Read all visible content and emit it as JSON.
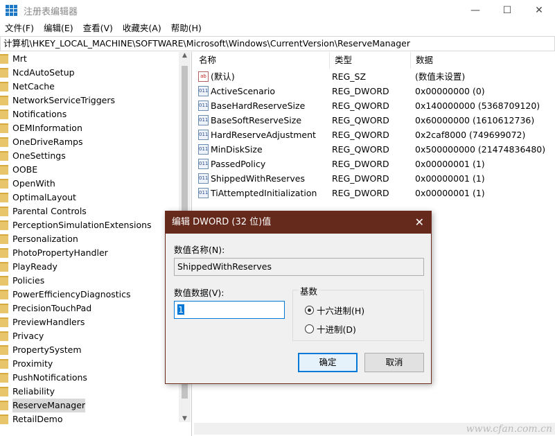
{
  "window": {
    "title": "注册表编辑器",
    "minimize": "—",
    "maximize": "☐",
    "close": "✕"
  },
  "menu": [
    "文件(F)",
    "编辑(E)",
    "查看(V)",
    "收藏夹(A)",
    "帮助(H)"
  ],
  "address": "计算机\\HKEY_LOCAL_MACHINE\\SOFTWARE\\Microsoft\\Windows\\CurrentVersion\\ReserveManager",
  "tree": {
    "items": [
      "Mrt",
      "NcdAutoSetup",
      "NetCache",
      "NetworkServiceTriggers",
      "Notifications",
      "OEMInformation",
      "OneDriveRamps",
      "OneSettings",
      "OOBE",
      "OpenWith",
      "OptimalLayout",
      "Parental Controls",
      "PerceptionSimulationExtensions",
      "Personalization",
      "PhotoPropertyHandler",
      "PlayReady",
      "Policies",
      "PowerEfficiencyDiagnostics",
      "PrecisionTouchPad",
      "PreviewHandlers",
      "Privacy",
      "PropertySystem",
      "Proximity",
      "PushNotifications",
      "Reliability",
      "ReserveManager",
      "RetailDemo"
    ],
    "selected": "ReserveManager"
  },
  "list": {
    "headers": [
      "名称",
      "类型",
      "数据"
    ],
    "rows": [
      {
        "icon": "string-value-icon",
        "name": "(默认)",
        "type": "REG_SZ",
        "data": "(数值未设置)"
      },
      {
        "icon": "binary-value-icon",
        "name": "ActiveScenario",
        "type": "REG_DWORD",
        "data": "0x00000000 (0)"
      },
      {
        "icon": "binary-value-icon",
        "name": "BaseHardReserveSize",
        "type": "REG_QWORD",
        "data": "0x140000000 (5368709120)"
      },
      {
        "icon": "binary-value-icon",
        "name": "BaseSoftReserveSize",
        "type": "REG_QWORD",
        "data": "0x60000000 (1610612736)"
      },
      {
        "icon": "binary-value-icon",
        "name": "HardReserveAdjustment",
        "type": "REG_QWORD",
        "data": "0x2caf8000 (749699072)"
      },
      {
        "icon": "binary-value-icon",
        "name": "MinDiskSize",
        "type": "REG_QWORD",
        "data": "0x500000000 (21474836480)"
      },
      {
        "icon": "binary-value-icon",
        "name": "PassedPolicy",
        "type": "REG_DWORD",
        "data": "0x00000001 (1)"
      },
      {
        "icon": "binary-value-icon",
        "name": "ShippedWithReserves",
        "type": "REG_DWORD",
        "data": "0x00000001 (1)"
      },
      {
        "icon": "binary-value-icon",
        "name": "TiAttemptedInitialization",
        "type": "REG_DWORD",
        "data": "0x00000001 (1)"
      }
    ]
  },
  "dialog": {
    "title": "编辑 DWORD (32 位)值",
    "close": "✕",
    "name_label": "数值名称(N):",
    "name_value": "ShippedWithReserves",
    "data_label": "数值数据(V):",
    "data_value": "1",
    "base_label": "基数",
    "hex_label": "十六进制(H)",
    "dec_label": "十进制(D)",
    "base_selected": "hex",
    "ok": "确定",
    "cancel": "取消",
    "title_color": "#652a1c"
  },
  "watermark": "www.cfan.com.cn"
}
